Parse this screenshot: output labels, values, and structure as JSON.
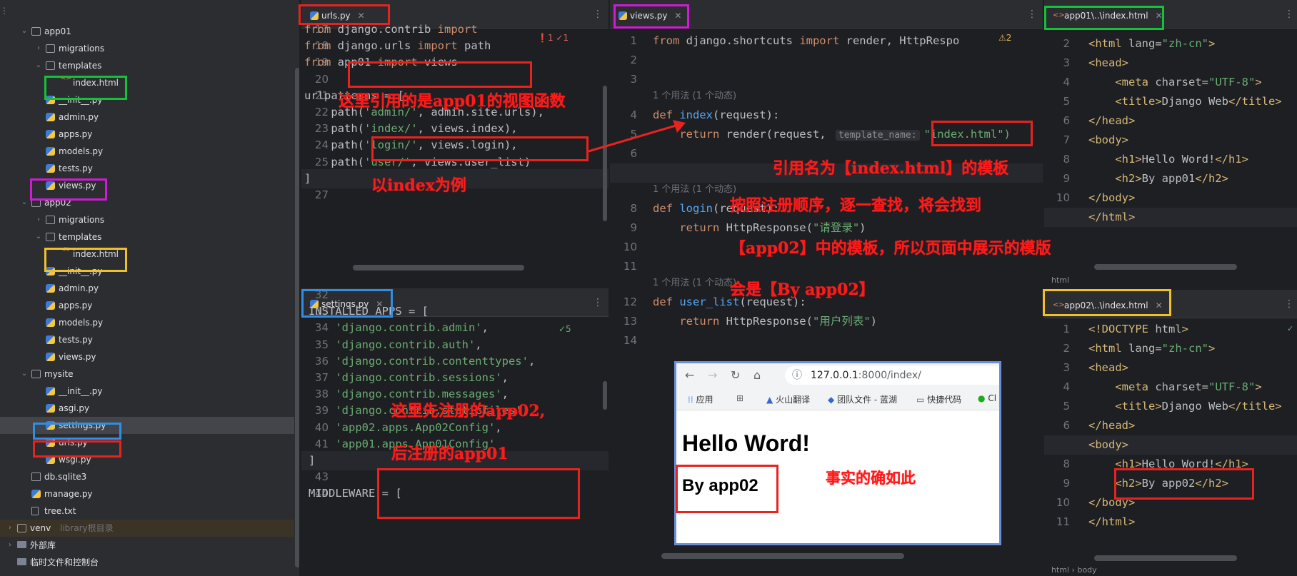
{
  "project_tree": [
    {
      "label": "app01",
      "type": "folder",
      "chev": "v"
    },
    {
      "label": "migrations",
      "type": "folder",
      "chev": ">"
    },
    {
      "label": "templates",
      "type": "folder",
      "chev": "v"
    },
    {
      "label": "index.html",
      "type": "html",
      "chev": ""
    },
    {
      "label": "__init__.py",
      "type": "py",
      "chev": ""
    },
    {
      "label": "admin.py",
      "type": "py",
      "chev": ""
    },
    {
      "label": "apps.py",
      "type": "py",
      "chev": ""
    },
    {
      "label": "models.py",
      "type": "py",
      "chev": ""
    },
    {
      "label": "tests.py",
      "type": "py",
      "chev": ""
    },
    {
      "label": "views.py",
      "type": "py",
      "chev": ""
    },
    {
      "label": "app02",
      "type": "folder",
      "chev": "v"
    },
    {
      "label": "migrations",
      "type": "folder",
      "chev": ">"
    },
    {
      "label": "templates",
      "type": "folder",
      "chev": "v"
    },
    {
      "label": "index.html",
      "type": "html",
      "chev": ""
    },
    {
      "label": "__init__.py",
      "type": "py",
      "chev": ""
    },
    {
      "label": "admin.py",
      "type": "py",
      "chev": ""
    },
    {
      "label": "apps.py",
      "type": "py",
      "chev": ""
    },
    {
      "label": "models.py",
      "type": "py",
      "chev": ""
    },
    {
      "label": "tests.py",
      "type": "py",
      "chev": ""
    },
    {
      "label": "views.py",
      "type": "py",
      "chev": ""
    },
    {
      "label": "mysite",
      "type": "folder",
      "chev": "v"
    },
    {
      "label": "__init__.py",
      "type": "py",
      "chev": ""
    },
    {
      "label": "asgi.py",
      "type": "py",
      "chev": ""
    },
    {
      "label": "settings.py",
      "type": "py",
      "chev": ""
    },
    {
      "label": "urls.py",
      "type": "py",
      "chev": ""
    },
    {
      "label": "wsgi.py",
      "type": "py",
      "chev": ""
    },
    {
      "label": "db.sqlite3",
      "type": "db",
      "chev": ""
    },
    {
      "label": "manage.py",
      "type": "py",
      "chev": ""
    },
    {
      "label": "tree.txt",
      "type": "txt",
      "chev": ""
    },
    {
      "label": "venv",
      "sub": "library根目录",
      "type": "folder",
      "chev": ">"
    },
    {
      "label": "外部库",
      "type": "lib",
      "chev": ">"
    },
    {
      "label": "临时文件和控制台",
      "type": "lib",
      "chev": ""
    }
  ],
  "tabs": {
    "urls": "urls.py",
    "views": "views.py",
    "app01_index": "app01\\..\\index.html",
    "settings": "settings.py",
    "app02_index": "app02\\..\\index.html"
  },
  "urls_editor": {
    "line_numbers": [
      "17",
      "18",
      "19",
      "20",
      "21",
      "22",
      "23",
      "24",
      "25",
      "26",
      "27"
    ],
    "lines": [
      [
        {
          "t": "from ",
          "c": "kw"
        },
        {
          "t": "django.contrib ",
          "c": "txtc"
        },
        {
          "t": "import",
          "c": "kw"
        }
      ],
      [
        {
          "t": "from ",
          "c": "kw"
        },
        {
          "t": "django.urls ",
          "c": "txtc"
        },
        {
          "t": "import ",
          "c": "kw"
        },
        {
          "t": "path",
          "c": "txtc"
        }
      ],
      [
        {
          "t": "from ",
          "c": "kw"
        },
        {
          "t": "app01 ",
          "c": "txtc"
        },
        {
          "t": "import ",
          "c": "kw"
        },
        {
          "t": "views",
          "c": "txtc"
        }
      ],
      [
        {
          "t": "",
          "c": "txtc"
        }
      ],
      [
        {
          "t": "urlpatterns = [",
          "c": "txtc"
        }
      ],
      [
        {
          "t": "    path(",
          "c": "txtc"
        },
        {
          "t": "'admin/'",
          "c": "str"
        },
        {
          "t": ", admin.site.urls),",
          "c": "txtc"
        }
      ],
      [
        {
          "t": "    path(",
          "c": "txtc"
        },
        {
          "t": "'index/'",
          "c": "str"
        },
        {
          "t": ", views.index),",
          "c": "txtc"
        }
      ],
      [
        {
          "t": "    path(",
          "c": "txtc"
        },
        {
          "t": "'login/'",
          "c": "str"
        },
        {
          "t": ", views.login),",
          "c": "txtc"
        }
      ],
      [
        {
          "t": "    path(",
          "c": "txtc"
        },
        {
          "t": "'user/'",
          "c": "str"
        },
        {
          "t": ", views.user_list)",
          "c": "txtc"
        }
      ],
      [
        {
          "t": "]",
          "c": "txtc"
        }
      ],
      [
        {
          "t": "",
          "c": "txtc"
        }
      ]
    ],
    "inspection": "❗1 ✓1"
  },
  "settings_editor": {
    "line_numbers": [
      "32",
      "33",
      "34",
      "35",
      "36",
      "37",
      "38",
      "39",
      "40",
      "41",
      "42",
      "43",
      "44"
    ],
    "lines": [
      [
        {
          "t": "",
          "c": "txtc"
        }
      ],
      [
        {
          "t": "INSTALLED_APPS = [",
          "c": "txtc"
        }
      ],
      [
        {
          "t": "    ",
          "c": "txtc"
        },
        {
          "t": "'django.contrib.admin'",
          "c": "str"
        },
        {
          "t": ",",
          "c": "txtc"
        }
      ],
      [
        {
          "t": "    ",
          "c": "txtc"
        },
        {
          "t": "'django.contrib.auth'",
          "c": "str"
        },
        {
          "t": ",",
          "c": "txtc"
        }
      ],
      [
        {
          "t": "    ",
          "c": "txtc"
        },
        {
          "t": "'django.contrib.contenttypes'",
          "c": "str"
        },
        {
          "t": ",",
          "c": "txtc"
        }
      ],
      [
        {
          "t": "    ",
          "c": "txtc"
        },
        {
          "t": "'django.contrib.sessions'",
          "c": "str"
        },
        {
          "t": ",",
          "c": "txtc"
        }
      ],
      [
        {
          "t": "    ",
          "c": "txtc"
        },
        {
          "t": "'django.contrib.messages'",
          "c": "str"
        },
        {
          "t": ",",
          "c": "txtc"
        }
      ],
      [
        {
          "t": "    ",
          "c": "txtc"
        },
        {
          "t": "'django.contrib.staticfiles'",
          "c": "str"
        },
        {
          "t": ",",
          "c": "txtc"
        }
      ],
      [
        {
          "t": "    ",
          "c": "txtc"
        },
        {
          "t": "'app02.apps.App02Config'",
          "c": "str"
        },
        {
          "t": ",",
          "c": "txtc"
        }
      ],
      [
        {
          "t": "    ",
          "c": "txtc"
        },
        {
          "t": "'app01.apps.App01Config'",
          "c": "str"
        }
      ],
      [
        {
          "t": "]",
          "c": "txtc"
        }
      ],
      [
        {
          "t": "",
          "c": "txtc"
        }
      ],
      [
        {
          "t": "MIDDLEWARE = [",
          "c": "txtc"
        }
      ]
    ],
    "inspection": "✓5"
  },
  "views_editor": {
    "line_numbers": [
      "1",
      "2",
      "3",
      "4",
      "5",
      "6",
      "7",
      "8",
      "9",
      "10",
      "11",
      "12",
      "13",
      "14"
    ],
    "usage_hint": "1 个用法 (1 个动态)",
    "lines": [
      [
        {
          "t": "from ",
          "c": "kw"
        },
        {
          "t": "django.shortcuts ",
          "c": "txtc"
        },
        {
          "t": "import ",
          "c": "kw"
        },
        {
          "t": "render, HttpRespo",
          "c": "txtc"
        }
      ],
      [
        {
          "t": "",
          "c": "txtc"
        }
      ],
      [
        {
          "t": "",
          "c": "txtc"
        }
      ],
      [
        {
          "t": "def ",
          "c": "kw"
        },
        {
          "t": "index",
          "c": "fn"
        },
        {
          "t": "(request):",
          "c": "txtc"
        }
      ],
      [
        {
          "t": "    return ",
          "c": "kw"
        },
        {
          "t": "render(request, ",
          "c": "txtc"
        }
      ],
      [
        {
          "t": "",
          "c": "txtc"
        }
      ],
      [
        {
          "t": "",
          "c": "txtc"
        }
      ],
      [
        {
          "t": "def ",
          "c": "kw"
        },
        {
          "t": "login",
          "c": "fn"
        },
        {
          "t": "(request):",
          "c": "txtc"
        }
      ],
      [
        {
          "t": "    return ",
          "c": "kw"
        },
        {
          "t": "HttpResponse(",
          "c": "txtc"
        },
        {
          "t": "\"请登录\"",
          "c": "str"
        },
        {
          "t": ")",
          "c": "txtc"
        }
      ],
      [
        {
          "t": "",
          "c": "txtc"
        }
      ],
      [
        {
          "t": "",
          "c": "txtc"
        }
      ],
      [
        {
          "t": "def ",
          "c": "kw"
        },
        {
          "t": "user_list",
          "c": "fn"
        },
        {
          "t": "(request):",
          "c": "txtc"
        }
      ],
      [
        {
          "t": "    return ",
          "c": "kw"
        },
        {
          "t": "HttpResponse(",
          "c": "txtc"
        },
        {
          "t": "\"用户列表\"",
          "c": "str"
        },
        {
          "t": ")",
          "c": "txtc"
        }
      ],
      [
        {
          "t": "",
          "c": "txtc"
        }
      ]
    ],
    "inlay_label": "template_name:",
    "inlay_value": "\"index.html\")",
    "inspection": "⚠2"
  },
  "app01_editor": {
    "line_numbers": [
      "2",
      "3",
      "4",
      "5",
      "6",
      "7",
      "8",
      "9",
      "10",
      "11"
    ],
    "lines": [
      [
        {
          "t": "<html ",
          "c": "tag"
        },
        {
          "t": "lang=",
          "c": "att"
        },
        {
          "t": "\"zh-cn\"",
          "c": "val"
        },
        {
          "t": ">",
          "c": "tag"
        }
      ],
      [
        {
          "t": "<head>",
          "c": "tag"
        }
      ],
      [
        {
          "t": "    <meta ",
          "c": "tag"
        },
        {
          "t": "charset=",
          "c": "att"
        },
        {
          "t": "\"UTF-8\"",
          "c": "val"
        },
        {
          "t": ">",
          "c": "tag"
        }
      ],
      [
        {
          "t": "    <title>",
          "c": "tag"
        },
        {
          "t": "Django Web",
          "c": "txtc"
        },
        {
          "t": "</title>",
          "c": "tag"
        }
      ],
      [
        {
          "t": "</head>",
          "c": "tag"
        }
      ],
      [
        {
          "t": "<body>",
          "c": "tag"
        }
      ],
      [
        {
          "t": "    <h1>",
          "c": "tag"
        },
        {
          "t": "Hello Word!",
          "c": "txtc"
        },
        {
          "t": "</h1>",
          "c": "tag"
        }
      ],
      [
        {
          "t": "    <h2>",
          "c": "tag"
        },
        {
          "t": "By app01",
          "c": "txtc"
        },
        {
          "t": "</h2>",
          "c": "tag"
        }
      ],
      [
        {
          "t": "</body>",
          "c": "tag"
        }
      ],
      [
        {
          "t": "</html>",
          "c": "tag"
        }
      ]
    ],
    "status": "html"
  },
  "app02_editor": {
    "line_numbers": [
      "1",
      "2",
      "3",
      "4",
      "5",
      "6",
      "7",
      "8",
      "9",
      "10",
      "11"
    ],
    "lines": [
      [
        {
          "t": "<!DOCTYPE ",
          "c": "tag"
        },
        {
          "t": "html",
          "c": "att"
        },
        {
          "t": ">",
          "c": "tag"
        }
      ],
      [
        {
          "t": "<html ",
          "c": "tag"
        },
        {
          "t": "lang=",
          "c": "att"
        },
        {
          "t": "\"zh-cn\"",
          "c": "val"
        },
        {
          "t": ">",
          "c": "tag"
        }
      ],
      [
        {
          "t": "<head>",
          "c": "tag"
        }
      ],
      [
        {
          "t": "    <meta ",
          "c": "tag"
        },
        {
          "t": "charset=",
          "c": "att"
        },
        {
          "t": "\"UTF-8\"",
          "c": "val"
        },
        {
          "t": ">",
          "c": "tag"
        }
      ],
      [
        {
          "t": "    <title>",
          "c": "tag"
        },
        {
          "t": "Django Web",
          "c": "txtc"
        },
        {
          "t": "</title>",
          "c": "tag"
        }
      ],
      [
        {
          "t": "</head>",
          "c": "tag"
        }
      ],
      [
        {
          "t": "<body>",
          "c": "tag"
        }
      ],
      [
        {
          "t": "    <h1>",
          "c": "tag"
        },
        {
          "t": "Hello Word!",
          "c": "txtc"
        },
        {
          "t": "</h1>",
          "c": "tag"
        }
      ],
      [
        {
          "t": "    <h2>",
          "c": "tag"
        },
        {
          "t": "By app02",
          "c": "txtc"
        },
        {
          "t": "</h2>",
          "c": "tag"
        }
      ],
      [
        {
          "t": "</body>",
          "c": "tag"
        }
      ],
      [
        {
          "t": "</html>",
          "c": "tag"
        }
      ]
    ],
    "breadcrumb": [
      "html",
      "body"
    ]
  },
  "browser": {
    "url_host": "127.0.0.1",
    "url_path": ":8000/index/",
    "bookmarks": [
      "应用",
      "火山翻译",
      "团队文件 - 蓝湖",
      "快捷代码",
      "Cl"
    ],
    "h1": "Hello Word!",
    "h2": "By app02"
  },
  "annotations": {
    "urls_note": "这里引用的是app01的视图函数",
    "index_example": "以index为例",
    "template_ref": "引用名为【index.html】的模板",
    "order_1": "按照注册顺序，逐一查找，将会找到",
    "order_2": "【app02】中的模板，所以页面中展示的模版",
    "order_3": "会是【By app02】",
    "first_reg": "这里先注册的app02,",
    "then_reg": "后注册的app01",
    "fact": "事实的确如此"
  },
  "colors": {
    "annotation_red": "#e8231f",
    "annotation_green": "#14c13a",
    "annotation_magenta": "#d119d8",
    "annotation_blue": "#2f8ee6",
    "annotation_yellow": "#f0c02a",
    "editor_bg": "#1e1f22",
    "keyword": "#cf8e6d",
    "string": "#6aab73"
  }
}
